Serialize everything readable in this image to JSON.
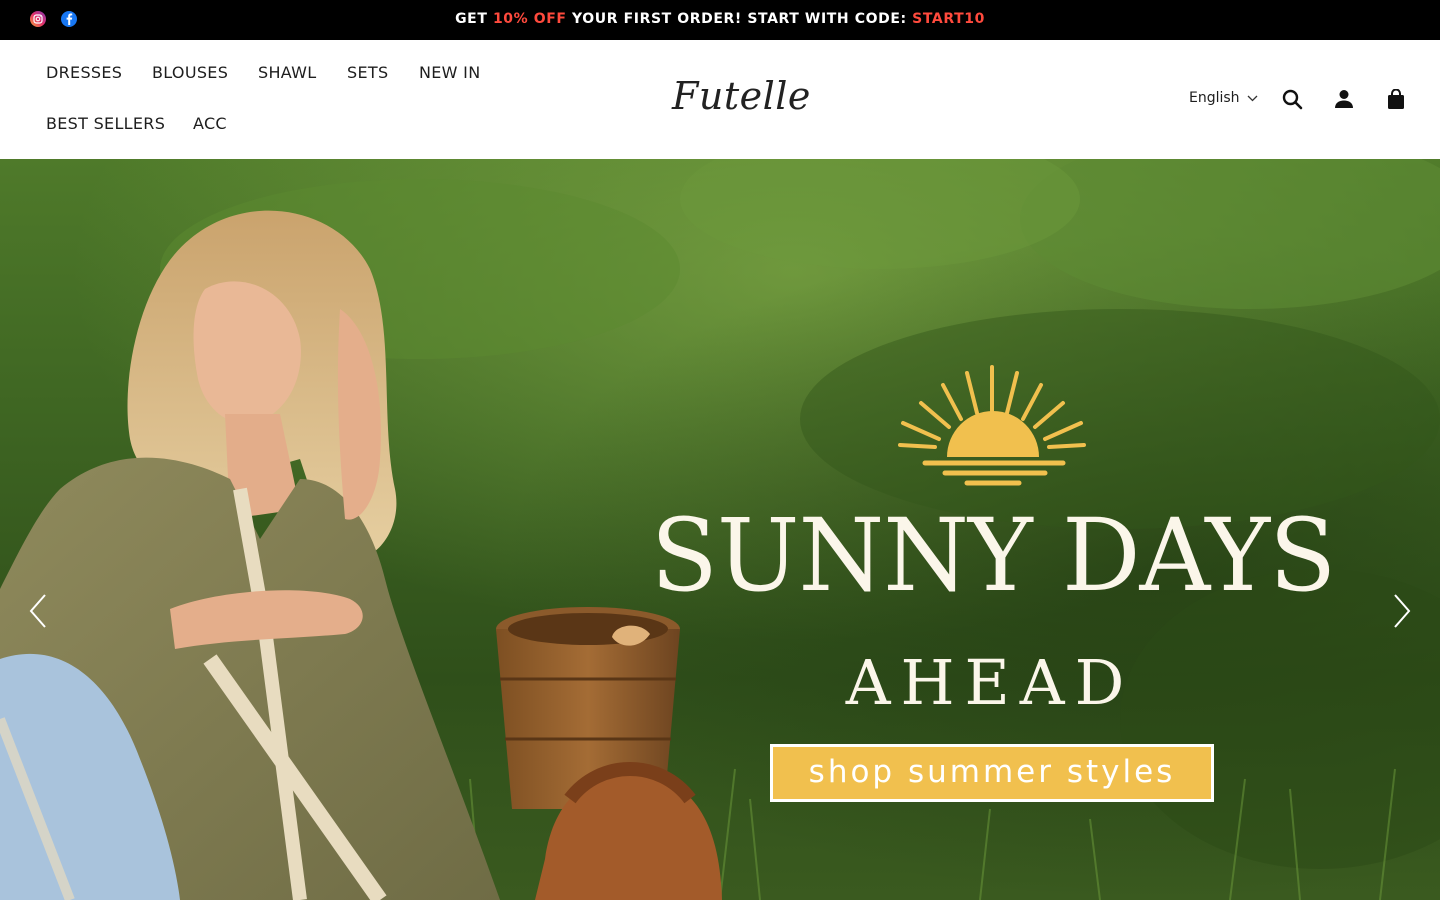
{
  "announcement": {
    "prefix": "GET ",
    "highlight": "10% OFF",
    "middle": " YOUR FIRST ORDER!  START WITH CODE: ",
    "code": "START10",
    "highlight_color": "#ff4a3d"
  },
  "social": [
    {
      "name": "instagram-icon"
    },
    {
      "name": "facebook-icon"
    }
  ],
  "nav": {
    "items": [
      "DRESSES",
      "BLOUSES",
      "SHAWL",
      "SETS",
      "NEW IN",
      "BEST SELLERS",
      "ACC"
    ]
  },
  "brand": {
    "logo_text": "Futelle"
  },
  "header_right": {
    "language": "English",
    "icons": [
      "search-icon",
      "account-icon",
      "cart-icon"
    ]
  },
  "hero": {
    "headline": "SUNNY DAYS",
    "subheadline": "AHEAD",
    "cta_label": "shop summer styles",
    "cta_color": "#f1c04e",
    "sun_color": "#f1c04e"
  }
}
